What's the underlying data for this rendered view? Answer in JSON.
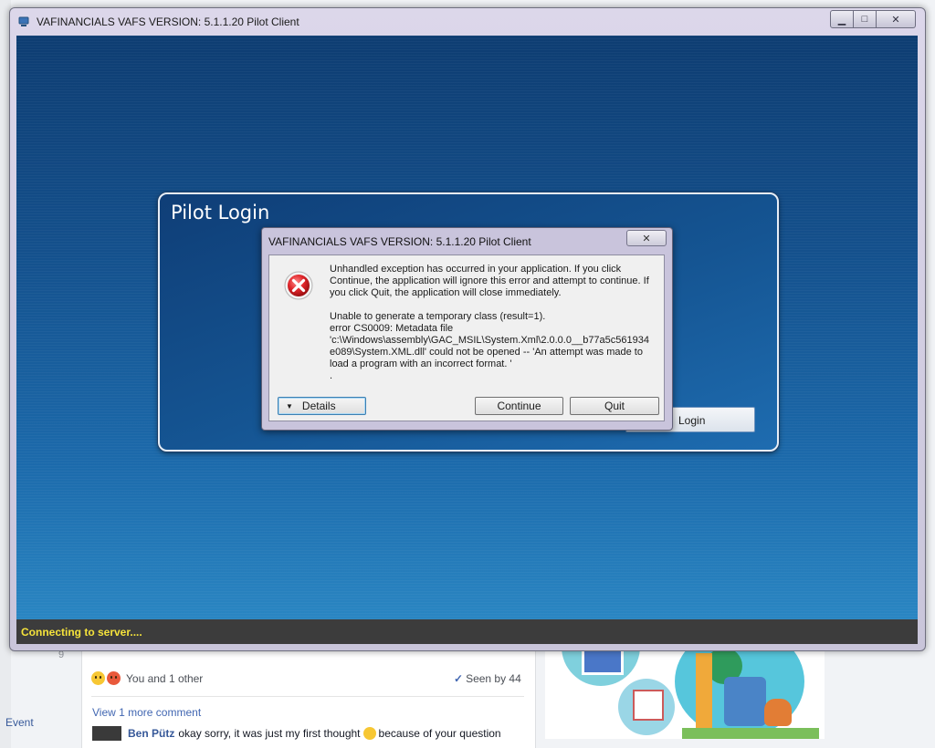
{
  "background": {
    "row_number": "9",
    "sidebar_link": "Event",
    "reactions_text": "You and 1 other",
    "seen_by": "Seen by 44",
    "view_more": "View 1 more comment",
    "comment_author": "Ben Pütz",
    "comment_text_before": "okay sorry, it was just my first thought",
    "comment_text_after": "because of your question"
  },
  "window": {
    "title": "VAFINANCIALS VAFS VERSION: 5.1.1.20 Pilot Client",
    "minimize_icon": "minimize-icon",
    "maximize_icon": "maximize-icon",
    "close_icon": "close-icon",
    "status_text": "Connecting to server....",
    "status_color": "#f5e33b"
  },
  "login": {
    "title": "Pilot Login",
    "login_button": "Login"
  },
  "dialog": {
    "title": "VAFINANCIALS VAFS VERSION: 5.1.1.20 Pilot Client",
    "icon": "error-icon",
    "message_intro": "Unhandled exception has occurred in your application. If you click\nContinue, the application will ignore this error and attempt to continue. If\nyou click Quit, the application will close immediately.",
    "message_detail": "Unable to generate a temporary class (result=1).\nerror CS0009: Metadata file\n'c:\\Windows\\assembly\\GAC_MSIL\\System.Xml\\2.0.0.0__b77a5c561934\ne089\\System.XML.dll' could not be opened -- 'An attempt was made to\nload a program with an incorrect format. '\n.",
    "details_button": "Details",
    "continue_button": "Continue",
    "quit_button": "Quit"
  }
}
